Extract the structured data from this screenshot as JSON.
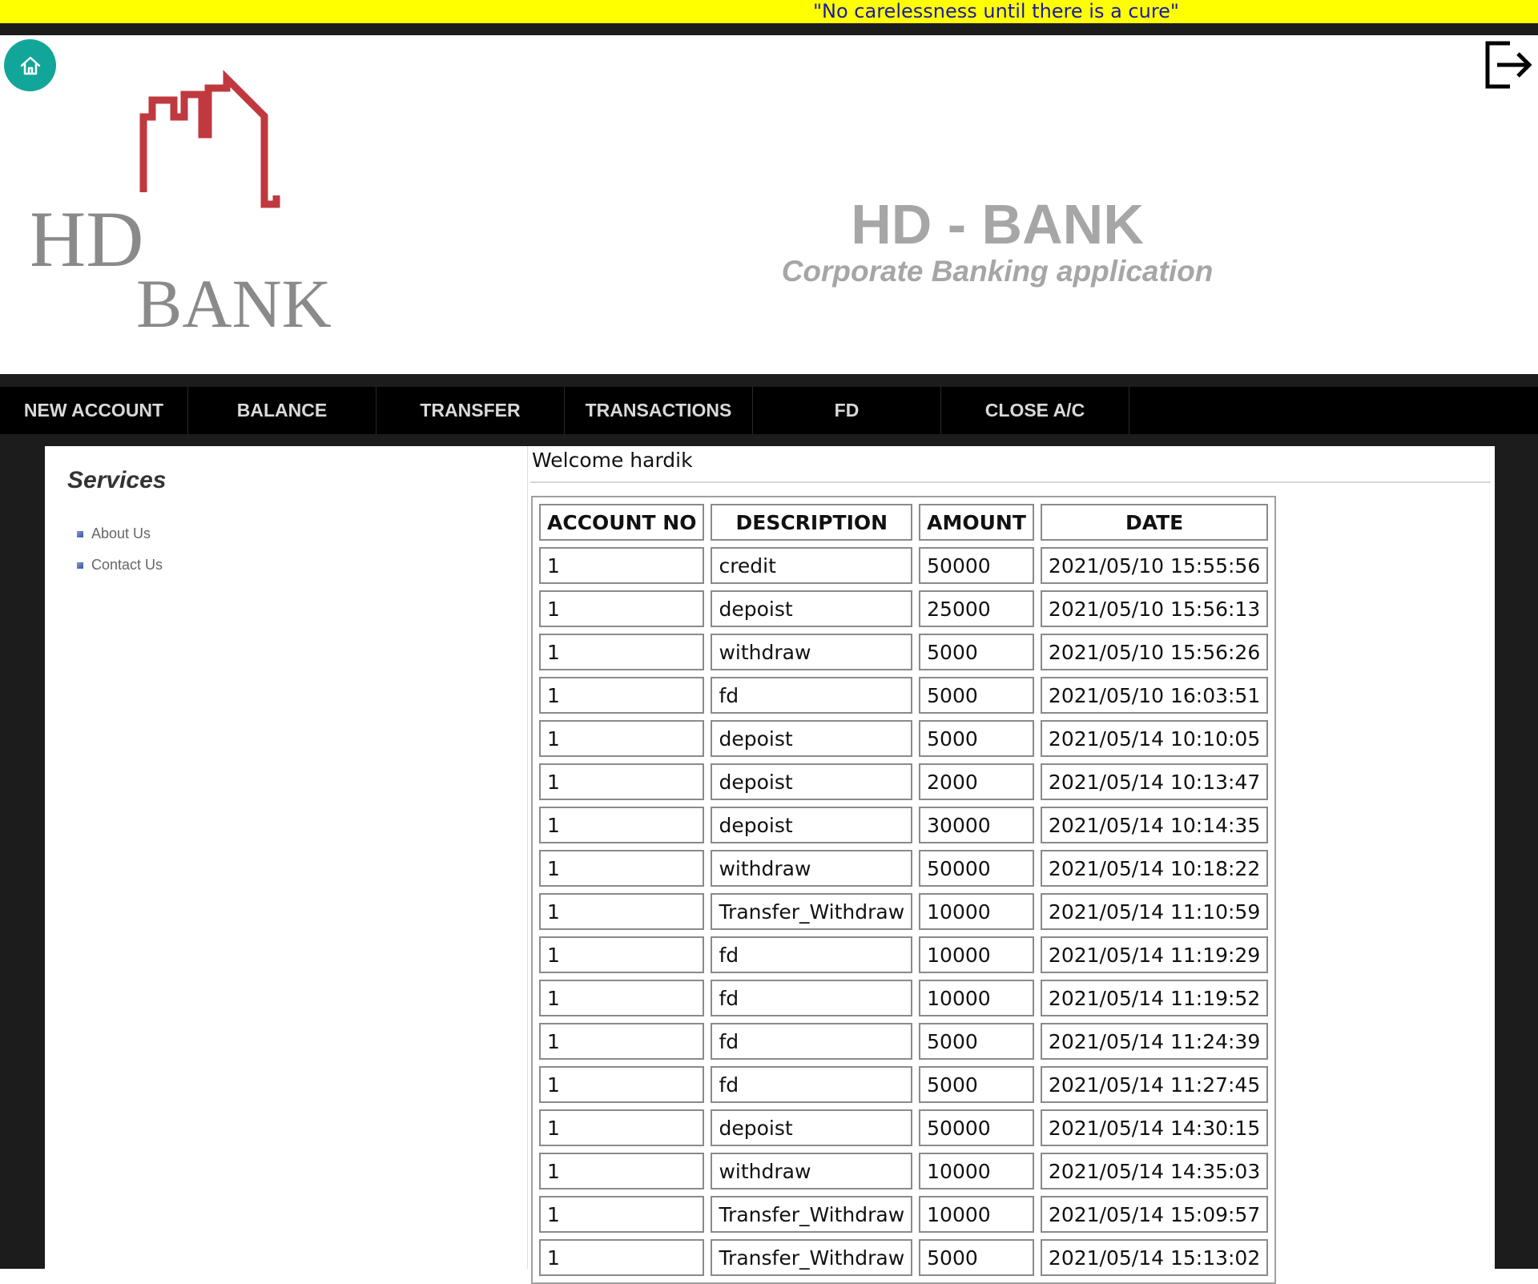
{
  "ticker": {
    "quote": "\"No carelessness until there is a cure\""
  },
  "logo": {
    "line1": "HD",
    "line2": "BANK"
  },
  "header": {
    "title": "HD - BANK",
    "subtitle": "Corporate Banking application"
  },
  "nav": {
    "items": [
      {
        "label": "NEW ACCOUNT"
      },
      {
        "label": "BALANCE"
      },
      {
        "label": "TRANSFER"
      },
      {
        "label": "TRANSACTIONS"
      },
      {
        "label": "FD"
      },
      {
        "label": "CLOSE A/C"
      }
    ]
  },
  "sidebar": {
    "title": "Services",
    "links": [
      {
        "label": "About Us"
      },
      {
        "label": "Contact Us"
      }
    ]
  },
  "main": {
    "welcome": "Welcome hardik",
    "table": {
      "headers": [
        "ACCOUNT NO",
        "DESCRIPTION",
        "AMOUNT",
        "DATE"
      ],
      "rows": [
        [
          "1",
          "credit",
          "50000",
          "2021/05/10 15:55:56"
        ],
        [
          "1",
          "depoist",
          "25000",
          "2021/05/10 15:56:13"
        ],
        [
          "1",
          "withdraw",
          "5000",
          "2021/05/10 15:56:26"
        ],
        [
          "1",
          "fd",
          "5000",
          "2021/05/10 16:03:51"
        ],
        [
          "1",
          "depoist",
          "5000",
          "2021/05/14 10:10:05"
        ],
        [
          "1",
          "depoist",
          "2000",
          "2021/05/14 10:13:47"
        ],
        [
          "1",
          "depoist",
          "30000",
          "2021/05/14 10:14:35"
        ],
        [
          "1",
          "withdraw",
          "50000",
          "2021/05/14 10:18:22"
        ],
        [
          "1",
          "Transfer_Withdraw",
          "10000",
          "2021/05/14 11:10:59"
        ],
        [
          "1",
          "fd",
          "10000",
          "2021/05/14 11:19:29"
        ],
        [
          "1",
          "fd",
          "10000",
          "2021/05/14 11:19:52"
        ],
        [
          "1",
          "fd",
          "5000",
          "2021/05/14 11:24:39"
        ],
        [
          "1",
          "fd",
          "5000",
          "2021/05/14 11:27:45"
        ],
        [
          "1",
          "depoist",
          "50000",
          "2021/05/14 14:30:15"
        ],
        [
          "1",
          "withdraw",
          "10000",
          "2021/05/14 14:35:03"
        ],
        [
          "1",
          "Transfer_Withdraw",
          "10000",
          "2021/05/14 15:09:57"
        ],
        [
          "1",
          "Transfer_Withdraw",
          "5000",
          "2021/05/14 15:13:02"
        ]
      ]
    }
  },
  "icons": {
    "home": "home-icon",
    "logout": "logout-icon"
  },
  "colors": {
    "ticker_bg": "#ffff00",
    "ticker_text": "#1a1aa6",
    "home_button": "#12a69a",
    "logo_red": "#c0393f",
    "title_gray": "#a6a6a6",
    "nav_bg": "#000000"
  }
}
